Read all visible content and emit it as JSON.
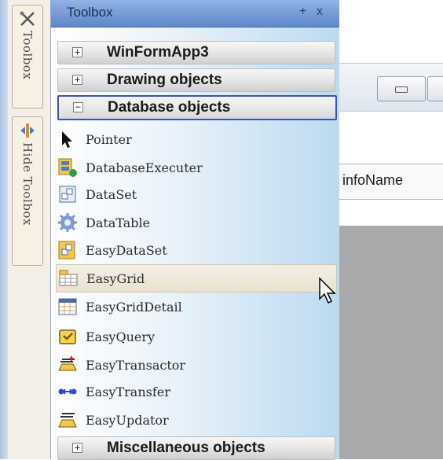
{
  "side_tabs": [
    {
      "label": "Toolbox",
      "icon": "toolbox-icon"
    },
    {
      "label": "Hide Toolbox",
      "icon": "hide-toolbox-icon"
    }
  ],
  "toolbox": {
    "title": "Toolbox",
    "pin_symbol": "+",
    "close_symbol": "x",
    "groups_top": [
      {
        "label": "WinFormApp3",
        "toggle": "+",
        "expanded": false
      },
      {
        "label": "Drawing objects",
        "toggle": "+",
        "expanded": false
      },
      {
        "label": "Database objects",
        "toggle": "−",
        "expanded": true
      }
    ],
    "items": [
      {
        "label": "Pointer",
        "icon": "pointer-icon"
      },
      {
        "label": "DatabaseExecuter",
        "icon": "database-executer-icon"
      },
      {
        "label": "DataSet",
        "icon": "dataset-icon"
      },
      {
        "label": "DataTable",
        "icon": "datatable-icon"
      },
      {
        "label": "EasyDataSet",
        "icon": "easy-dataset-icon"
      },
      {
        "label": "EasyGrid",
        "icon": "easy-grid-icon",
        "hovered": true
      },
      {
        "label": "EasyGridDetail",
        "icon": "easy-grid-detail-icon"
      },
      {
        "label": "EasyQuery",
        "icon": "easy-query-icon"
      },
      {
        "label": "EasyTransactor",
        "icon": "easy-transactor-icon"
      },
      {
        "label": "EasyTransfer",
        "icon": "easy-transfer-icon"
      },
      {
        "label": "EasyUpdator",
        "icon": "easy-updator-icon"
      }
    ],
    "groups_bottom": [
      {
        "label": "Miscellaneous objects",
        "toggle": "+",
        "expanded": false
      }
    ]
  },
  "designer": {
    "column_header": "infoName"
  },
  "colors": {
    "title_bar": "#6f97d6",
    "group_border_selected": "#3b4fc5",
    "panel_gradient_right": "#bcdaf0",
    "gray_area": "#a9a9a9"
  }
}
